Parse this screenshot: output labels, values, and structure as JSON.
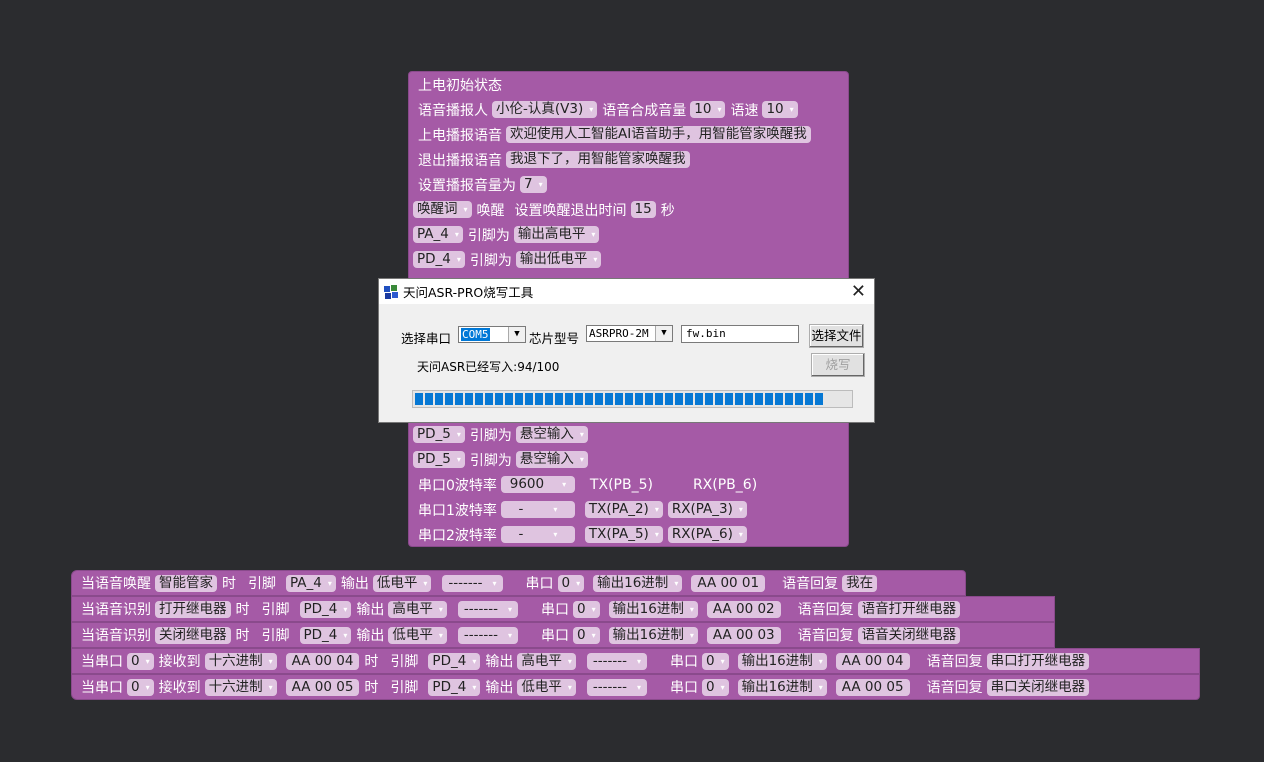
{
  "init_block": {
    "title": "上电初始状态",
    "speaker_label": "语音播报人",
    "speaker_value": "小伦-认真(V3)",
    "synth_volume_label": "语音合成音量",
    "synth_volume_value": "10",
    "speed_label": "语速",
    "speed_value": "10",
    "poweron_label": "上电播报语音",
    "poweron_text": "欢迎使用人工智能AI语音助手，用智能管家唤醒我",
    "exit_label": "退出播报语音",
    "exit_text": "我退下了，用智能管家唤醒我",
    "set_volume_label": "设置播报音量为",
    "set_volume_value": "7",
    "wake_word_select": "唤醒词",
    "wake_label": "唤醒",
    "wake_timeout_label": "设置唤醒退出时间",
    "wake_timeout_value": "15",
    "seconds_label": "秒",
    "pin_label": "引脚为",
    "pins": [
      {
        "pin": "PA_4",
        "mode": "输出高电平"
      },
      {
        "pin": "PD_4",
        "mode": "输出低电平"
      },
      {
        "pin": "PD_5",
        "mode": "悬空输入"
      },
      {
        "pin": "PD_5",
        "mode": "悬空输入"
      }
    ],
    "uart0_label": "串口0波特率",
    "uart0_baud": "9600",
    "uart0_tx": "TX(PB_5)",
    "uart0_rx": "RX(PB_6)",
    "uart1_label": "串口1波特率",
    "uart1_baud": "-",
    "uart1_tx": "TX(PA_2)",
    "uart1_rx": "RX(PA_3)",
    "uart2_label": "串口2波特率",
    "uart2_baud": "-",
    "uart2_tx": "TX(PA_5)",
    "uart2_rx": "RX(PA_6)"
  },
  "dialog": {
    "title": "天问ASR-PRO烧写工具",
    "port_label": "选择串口",
    "port_value": "COM5",
    "chip_label": "芯片型号",
    "chip_value": "ASRPRO-2M",
    "file_value": "fw.bin",
    "choose_file_button": "选择文件",
    "burn_button": "烧写",
    "status_text": "天问ASR已经写入:94/100",
    "progress": 94
  },
  "rules": {
    "when_wake": "当语音唤醒",
    "when_recognize": "当语音识别",
    "when_uart": "当串口",
    "time_label": "时",
    "pin_label": "引脚",
    "output_label": "输出",
    "uart_label": "串口",
    "received_label": "接收到",
    "reply_label": "语音回复",
    "items": [
      {
        "type": "wake",
        "trigger": "智能管家",
        "pin": "PA_4",
        "level": "低电平",
        "extra": "-------",
        "uart": "0",
        "fmt": "输出16进制",
        "hex": "AA 00 01",
        "reply": "我在"
      },
      {
        "type": "recognize",
        "trigger": "打开继电器",
        "pin": "PD_4",
        "level": "高电平",
        "extra": "-------",
        "uart": "0",
        "fmt": "输出16进制",
        "hex": "AA 00 02",
        "reply": "语音打开继电器"
      },
      {
        "type": "recognize",
        "trigger": "关闭继电器",
        "pin": "PD_4",
        "level": "低电平",
        "extra": "-------",
        "uart": "0",
        "fmt": "输出16进制",
        "hex": "AA 00 03",
        "reply": "语音关闭继电器"
      },
      {
        "type": "uart",
        "in_uart": "0",
        "in_fmt": "十六进制",
        "in_hex": "AA 00 04",
        "pin": "PD_4",
        "level": "高电平",
        "extra": "-------",
        "uart": "0",
        "fmt": "输出16进制",
        "hex": "AA 00 04",
        "reply": "串口打开继电器"
      },
      {
        "type": "uart",
        "in_uart": "0",
        "in_fmt": "十六进制",
        "in_hex": "AA 00 05",
        "pin": "PD_4",
        "level": "低电平",
        "extra": "-------",
        "uart": "0",
        "fmt": "输出16进制",
        "hex": "AA 00 05",
        "reply": "串口关闭继电器"
      }
    ]
  },
  "icons": {
    "dropdown_arrow": "▾",
    "combo_arrow": "▼",
    "close": "✕"
  }
}
